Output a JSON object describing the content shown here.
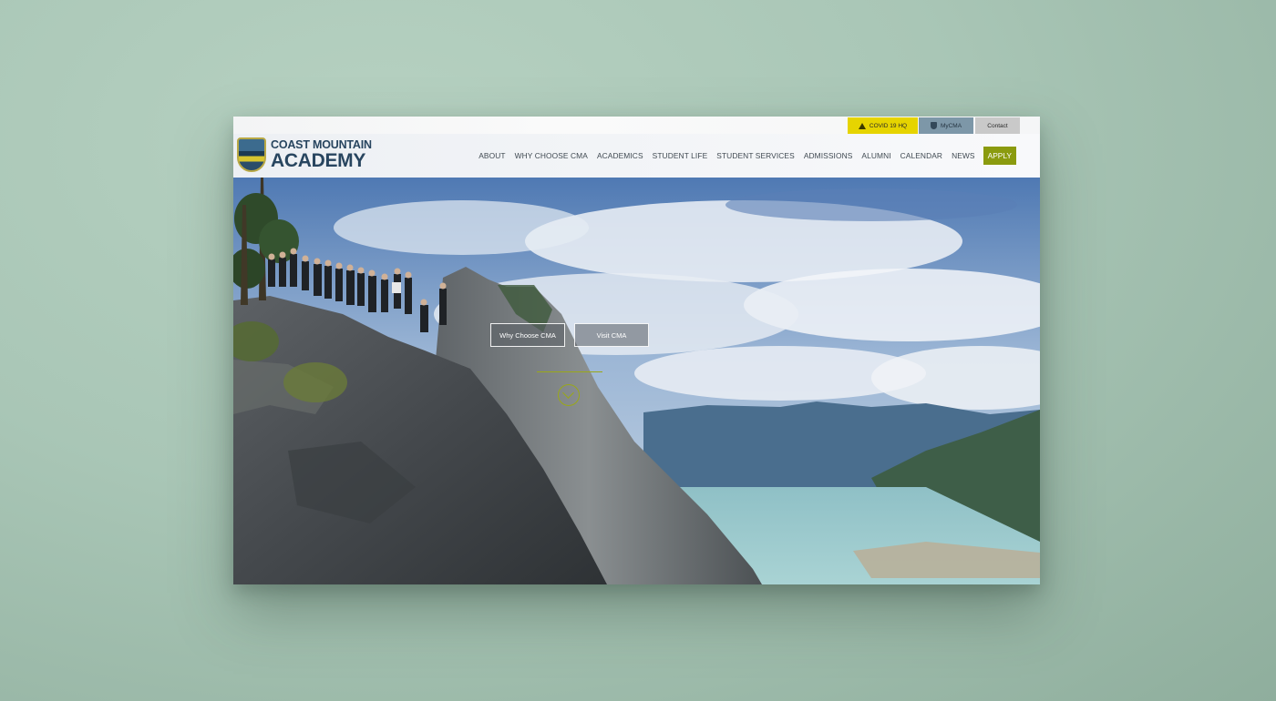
{
  "utility_bar": {
    "covid_label": "COVID 19 HQ",
    "mycma_label": "MyCMA",
    "contact_label": "Contact"
  },
  "brand": {
    "line1": "COAST MOUNTAIN",
    "line2": "ACADEMY"
  },
  "nav": {
    "items": [
      "ABOUT",
      "WHY CHOOSE CMA",
      "ACADEMICS",
      "STUDENT LIFE",
      "STUDENT SERVICES",
      "ADMISSIONS",
      "ALUMNI",
      "CALENDAR",
      "NEWS"
    ],
    "apply_label": "APPLY"
  },
  "hero": {
    "cta_primary": "Why Choose CMA",
    "cta_secondary": "Visit CMA"
  },
  "colors": {
    "accent_green": "#8b9b0f",
    "covid_yellow": "#e6d400",
    "mycma_blue": "#7d97a8",
    "brand_navy": "#28455f"
  },
  "icons": [
    "warning-icon",
    "shield-icon",
    "chevron-down-icon"
  ]
}
